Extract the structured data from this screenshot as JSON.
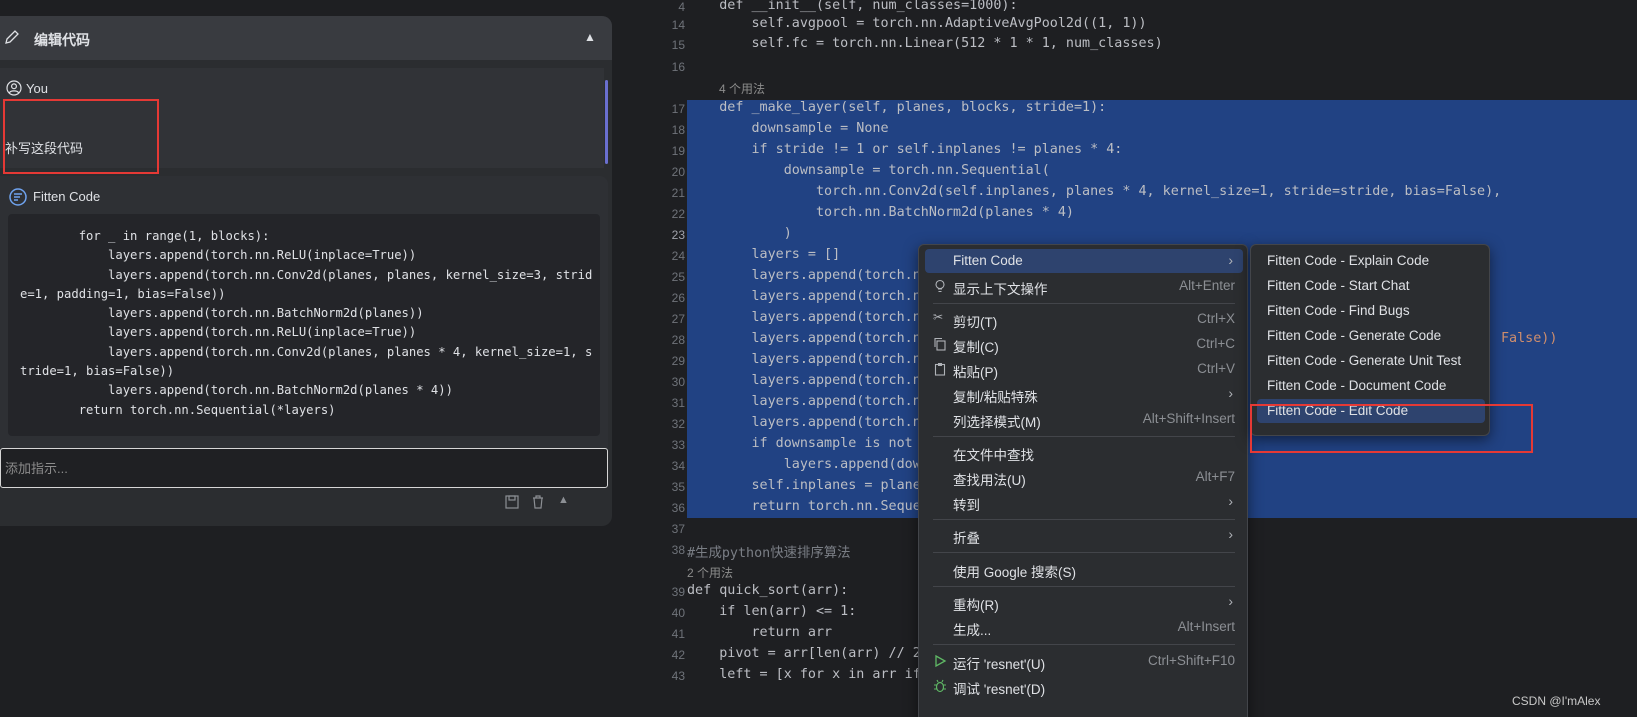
{
  "chat": {
    "header_title": "编辑代码",
    "user_name": "You",
    "user_message": "补写这段代码",
    "assistant_name": "Fitten Code",
    "code_lines": [
      "        for _ in range(1, blocks):",
      "            layers.append(torch.nn.ReLU(inplace=True))",
      "            layers.append(torch.nn.Conv2d(planes, planes, kernel_size=3, strid",
      "e=1, padding=1, bias=False))",
      "            layers.append(torch.nn.BatchNorm2d(planes))",
      "            layers.append(torch.nn.ReLU(inplace=True))",
      "            layers.append(torch.nn.Conv2d(planes, planes * 4, kernel_size=1, s",
      "tride=1, bias=False))",
      "            layers.append(torch.nn.BatchNorm2d(planes * 4))",
      "        return torch.nn.Sequential(*layers)"
    ],
    "input_placeholder": "添加指示..."
  },
  "editor": {
    "line_numbers": [
      "4",
      "14",
      "15",
      "16",
      "17",
      "18",
      "19",
      "20",
      "21",
      "22",
      "23",
      "24",
      "25",
      "26",
      "27",
      "28",
      "29",
      "30",
      "31",
      "32",
      "33",
      "34",
      "35",
      "36",
      "37",
      "38",
      "39",
      "40",
      "41",
      "42",
      "43"
    ],
    "usage_hint_1": "4 个用法",
    "usage_hint_2": "2 个用法",
    "comment": "#生成python快速排序算法",
    "lines": {
      "l4": "    def __init__(self, num_classes=1000):",
      "l14": "        self.avgpool = torch.nn.AdaptiveAvgPool2d((1, 1))",
      "l15": "        self.fc = torch.nn.Linear(512 * 1 * 1, num_classes)",
      "l17": "    def _make_layer(self, planes, blocks, stride=1):",
      "l18": "        downsample = None",
      "l19": "        if stride != 1 or self.inplanes != planes * 4:",
      "l20": "            downsample = torch.nn.Sequential(",
      "l21": "                torch.nn.Conv2d(self.inplanes, planes * 4, kernel_size=1, stride=stride, bias=False),",
      "l22": "                torch.nn.BatchNorm2d(planes * 4)",
      "l23": "            )",
      "l24": "        layers = []",
      "l25": "        layers.append(torch.n",
      "l26": "        layers.append(torch.n",
      "l27": "        layers.append(torch.n",
      "l28": "        layers.append(torch.n",
      "l28_tail": "False))",
      "l29": "        layers.append(torch.n",
      "l30": "        layers.append(torch.n",
      "l31": "        layers.append(torch.n",
      "l32": "        layers.append(torch.n",
      "l33": "        if downsample is not",
      "l34": "            layers.append(dow",
      "l35": "        self.inplanes = plane",
      "l36": "        return torch.nn.Seque",
      "l39": "def quick_sort(arr):",
      "l40": "    if len(arr) <= 1:",
      "l41": "        return arr",
      "l42": "    pivot = arr[len(arr) // 2",
      "l43": "    left = [x for x in arr if"
    }
  },
  "context_menu": {
    "items": [
      {
        "label": "Fitten Code",
        "shortcut": "",
        "submenu": true
      },
      {
        "label": "显示上下文操作",
        "shortcut": "Alt+Enter"
      },
      {
        "label": "剪切(T)",
        "shortcut": "Ctrl+X"
      },
      {
        "label": "复制(C)",
        "shortcut": "Ctrl+C"
      },
      {
        "label": "粘贴(P)",
        "shortcut": "Ctrl+V"
      },
      {
        "label": "复制/粘贴特殊",
        "shortcut": "",
        "submenu": true
      },
      {
        "label": "列选择模式(M)",
        "shortcut": "Alt+Shift+Insert"
      },
      {
        "label": "在文件中查找",
        "shortcut": ""
      },
      {
        "label": "查找用法(U)",
        "shortcut": "Alt+F7"
      },
      {
        "label": "转到",
        "shortcut": "",
        "submenu": true
      },
      {
        "label": "折叠",
        "shortcut": "",
        "submenu": true
      },
      {
        "label": "使用 Google 搜索(S)",
        "shortcut": ""
      },
      {
        "label": "重构(R)",
        "shortcut": "",
        "submenu": true
      },
      {
        "label": "生成...",
        "shortcut": "Alt+Insert"
      },
      {
        "label": "运行 'resnet'(U)",
        "shortcut": "Ctrl+Shift+F10"
      },
      {
        "label": "调试 'resnet'(D)",
        "shortcut": ""
      }
    ]
  },
  "submenu": {
    "items": [
      "Fitten Code - Explain Code",
      "Fitten Code - Start Chat",
      "Fitten Code - Find Bugs",
      "Fitten Code - Generate Code",
      "Fitten Code - Generate Unit Test",
      "Fitten Code - Document Code",
      "Fitten Code - Edit Code"
    ]
  },
  "watermark": "CSDN @I'mAlex",
  "colors": {
    "selection": "#214283",
    "menu_highlight": "#2e436e",
    "annotation_red": "#e53935"
  }
}
